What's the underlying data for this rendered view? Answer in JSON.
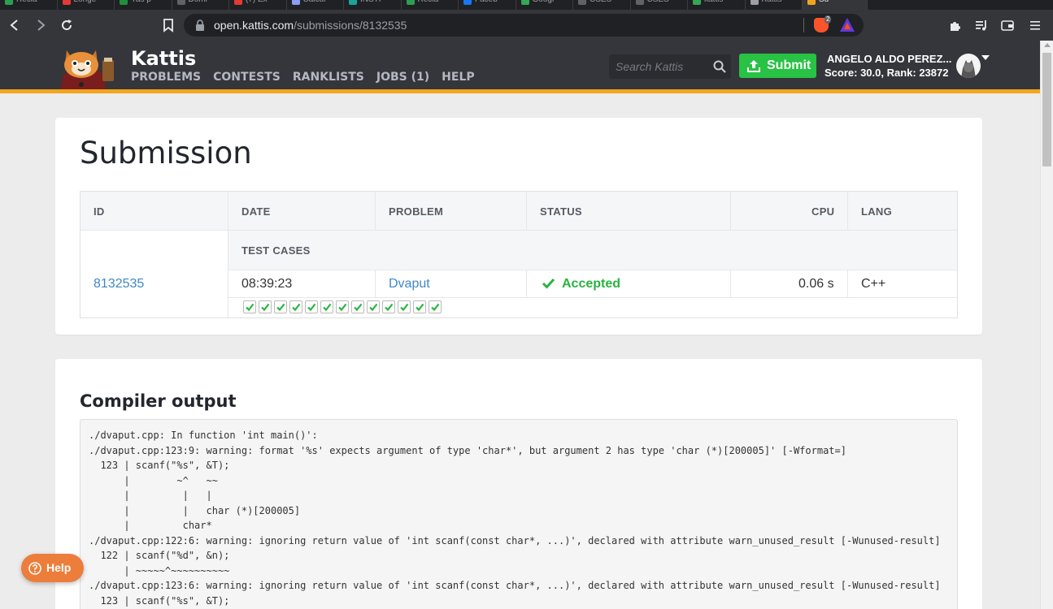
{
  "browser": {
    "tabs": [
      {
        "label": "Recla",
        "color": "#2c9e52"
      },
      {
        "label": "Longe",
        "color": "#e53935"
      },
      {
        "label": "Yas p",
        "color": "#1f8f3e"
      },
      {
        "label": "Domi",
        "color": "#5f6368"
      },
      {
        "label": "(7) Ex",
        "color": "#e53935"
      },
      {
        "label": "Calcul",
        "color": "#8e9cf5"
      },
      {
        "label": "INSTI",
        "color": "#1aa59b"
      },
      {
        "label": "Recla",
        "color": "#2c9e52"
      },
      {
        "label": "Faceb",
        "color": "#1877f2"
      },
      {
        "label": "Googl",
        "color": "#34a853"
      },
      {
        "label": "CSES",
        "color": "#5f6368"
      },
      {
        "label": "CSES",
        "color": "#5f6368"
      },
      {
        "label": "kattis",
        "color": "#34a853"
      },
      {
        "label": "Kattis",
        "color": "#9aa0a6"
      },
      {
        "label": "Su",
        "color": "#f2a51c"
      }
    ],
    "url_host": "open.kattis.com",
    "url_path": "/submissions/8132535",
    "brave_count": "2"
  },
  "header": {
    "brand": "Kattis",
    "nav": [
      "PROBLEMS",
      "CONTESTS",
      "RANKLISTS",
      "JOBS (1)",
      "HELP"
    ],
    "search_placeholder": "Search Kattis",
    "submit_label": "Submit",
    "user_name": "ANGELO ALDO PEREZ...",
    "user_score": "Score: 30.0, Rank: 23872",
    "accent_color": "#f2a51c",
    "submit_color": "#28c244"
  },
  "submission": {
    "title": "Submission",
    "columns": {
      "id": "ID",
      "date": "DATE",
      "problem": "PROBLEM",
      "status": "STATUS",
      "cpu": "CPU",
      "lang": "LANG",
      "test_cases": "TEST CASES"
    },
    "row": {
      "id": "8132535",
      "date": "08:39:23",
      "problem": "Dvaput",
      "status": "Accepted",
      "cpu": "0.06 s",
      "lang": "C++"
    },
    "test_cases_passed": 13,
    "status_color": "#28b440"
  },
  "compiler": {
    "title": "Compiler output",
    "lines": [
      "./dvaput.cpp: In function 'int main()':",
      "./dvaput.cpp:123:9: warning: format '%s' expects argument of type 'char*', but argument 2 has type 'char (*)[200005]' [-Wformat=]",
      "  123 | scanf(\"%s\", &T);",
      "      |        ~^   ~~",
      "      |         |   |",
      "      |         |   char (*)[200005]",
      "      |         char*",
      "./dvaput.cpp:122:6: warning: ignoring return value of 'int scanf(const char*, ...)', declared with attribute warn_unused_result [-Wunused-result]",
      "  122 | scanf(\"%d\", &n);",
      "      | ~~~~~^~~~~~~~~~~",
      "./dvaput.cpp:123:6: warning: ignoring return value of 'int scanf(const char*, ...)', declared with attribute warn_unused_result [-Wunused-result]",
      "  123 | scanf(\"%s\", &T);"
    ]
  },
  "help_widget": {
    "label": "Help"
  }
}
